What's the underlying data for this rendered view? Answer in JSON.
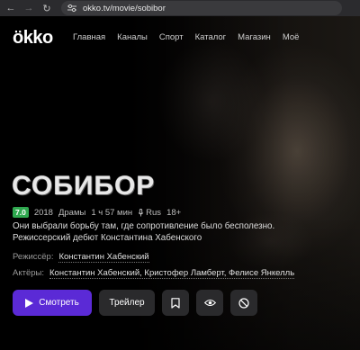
{
  "browser": {
    "url": "okko.tv/movie/sobibor"
  },
  "header": {
    "logo": "ökko",
    "menu": [
      "Главная",
      "Каналы",
      "Спорт",
      "Каталог",
      "Магазин",
      "Моё"
    ]
  },
  "movie": {
    "title": "СОБИБОР",
    "rating": "7.0",
    "year": "2018",
    "genre": "Драмы",
    "duration": "1 ч 57 мин",
    "audio": "Rus",
    "age": "18+",
    "description": "Они выбрали борьбу там, где сопротивление было бесполезно. Режиссерский дебют Константина Хабенского",
    "director_label": "Режиссёр:",
    "director": "Константин Хабенский",
    "actors_label": "Актёры:",
    "actors": "Константин Хабенский, Кристофер Ламберт, Фелисе Янкелль"
  },
  "actions": {
    "watch_label": "Смотреть",
    "trailer_label": "Трейлер"
  },
  "colors": {
    "accent": "#5b2ad6",
    "rating": "#2fa84f"
  }
}
